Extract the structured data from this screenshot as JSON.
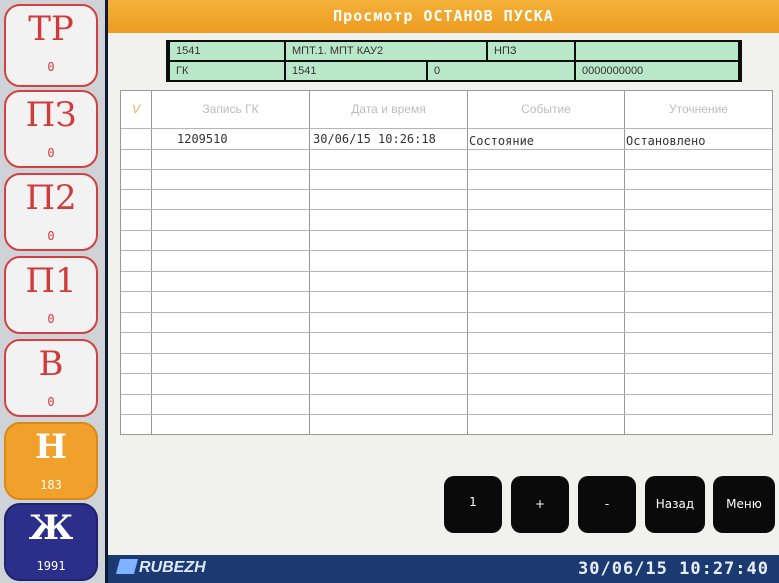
{
  "sidebar": {
    "items": [
      {
        "label": "ТР",
        "count": "0"
      },
      {
        "label": "ПЗ",
        "count": "0"
      },
      {
        "label": "П2",
        "count": "0"
      },
      {
        "label": "П1",
        "count": "0"
      },
      {
        "label": "В",
        "count": "0"
      },
      {
        "label": "Н",
        "count": "183"
      },
      {
        "label": "Ж",
        "count": "1991"
      }
    ]
  },
  "header": {
    "title": "Просмотр ОСТАНОВ ПУСКА"
  },
  "info": {
    "row1": {
      "id": "1541",
      "name": "МПТ.1. МПТ КАУ2",
      "type": "НПЗ",
      "extra": ""
    },
    "row2": {
      "label": "ГК",
      "number": "1541",
      "zero": "0",
      "code": "0000000000"
    }
  },
  "table": {
    "columns": [
      "V",
      "Запись ГК",
      "Дата и время",
      "Событие",
      "Уточнение"
    ],
    "rows": [
      {
        "record": "1209510",
        "datetime": "30/06/15 10:26:18",
        "event": "Состояние",
        "detail": "Остановлено"
      }
    ]
  },
  "buttons": {
    "one": "1",
    "plus": "+",
    "minus": "-",
    "back": "Назад",
    "menu": "Меню"
  },
  "status": {
    "brand": "RUBEZH",
    "datetime": "30/06/15 10:27:40"
  },
  "colors": {
    "accent": "#f0a02b",
    "alarm": "#d04141",
    "info_bg": "#b9e8c9",
    "status_bar": "#1c3a72"
  }
}
